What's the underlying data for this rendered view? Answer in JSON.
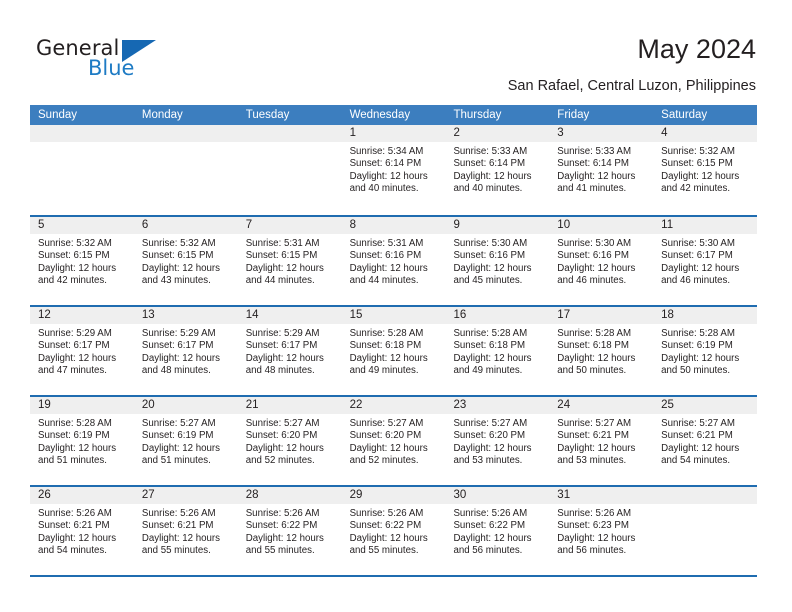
{
  "brand": {
    "name_part1": "General",
    "name_part2": "Blue",
    "triangle_color": "#1668b3",
    "blue_color": "#1e7bc4"
  },
  "header": {
    "title": "May 2024",
    "subtitle": "San Rafael, Central Luzon, Philippines"
  },
  "theme": {
    "header_blue": "#3c7ebf",
    "rule_blue": "#1f6cb0",
    "day_strip_gray": "#efefef",
    "text": "#231f20"
  },
  "calendar": {
    "weekdays": [
      "Sunday",
      "Monday",
      "Tuesday",
      "Wednesday",
      "Thursday",
      "Friday",
      "Saturday"
    ],
    "weeks": [
      [
        {
          "day": "",
          "sunrise": "",
          "sunset": "",
          "daylight": "",
          "empty": true
        },
        {
          "day": "",
          "sunrise": "",
          "sunset": "",
          "daylight": "",
          "empty": true
        },
        {
          "day": "",
          "sunrise": "",
          "sunset": "",
          "daylight": "",
          "empty": true
        },
        {
          "day": "1",
          "sunrise": "Sunrise: 5:34 AM",
          "sunset": "Sunset: 6:14 PM",
          "daylight": "Daylight: 12 hours and 40 minutes."
        },
        {
          "day": "2",
          "sunrise": "Sunrise: 5:33 AM",
          "sunset": "Sunset: 6:14 PM",
          "daylight": "Daylight: 12 hours and 40 minutes."
        },
        {
          "day": "3",
          "sunrise": "Sunrise: 5:33 AM",
          "sunset": "Sunset: 6:14 PM",
          "daylight": "Daylight: 12 hours and 41 minutes."
        },
        {
          "day": "4",
          "sunrise": "Sunrise: 5:32 AM",
          "sunset": "Sunset: 6:15 PM",
          "daylight": "Daylight: 12 hours and 42 minutes."
        }
      ],
      [
        {
          "day": "5",
          "sunrise": "Sunrise: 5:32 AM",
          "sunset": "Sunset: 6:15 PM",
          "daylight": "Daylight: 12 hours and 42 minutes."
        },
        {
          "day": "6",
          "sunrise": "Sunrise: 5:32 AM",
          "sunset": "Sunset: 6:15 PM",
          "daylight": "Daylight: 12 hours and 43 minutes."
        },
        {
          "day": "7",
          "sunrise": "Sunrise: 5:31 AM",
          "sunset": "Sunset: 6:15 PM",
          "daylight": "Daylight: 12 hours and 44 minutes."
        },
        {
          "day": "8",
          "sunrise": "Sunrise: 5:31 AM",
          "sunset": "Sunset: 6:16 PM",
          "daylight": "Daylight: 12 hours and 44 minutes."
        },
        {
          "day": "9",
          "sunrise": "Sunrise: 5:30 AM",
          "sunset": "Sunset: 6:16 PM",
          "daylight": "Daylight: 12 hours and 45 minutes."
        },
        {
          "day": "10",
          "sunrise": "Sunrise: 5:30 AM",
          "sunset": "Sunset: 6:16 PM",
          "daylight": "Daylight: 12 hours and 46 minutes."
        },
        {
          "day": "11",
          "sunrise": "Sunrise: 5:30 AM",
          "sunset": "Sunset: 6:17 PM",
          "daylight": "Daylight: 12 hours and 46 minutes."
        }
      ],
      [
        {
          "day": "12",
          "sunrise": "Sunrise: 5:29 AM",
          "sunset": "Sunset: 6:17 PM",
          "daylight": "Daylight: 12 hours and 47 minutes."
        },
        {
          "day": "13",
          "sunrise": "Sunrise: 5:29 AM",
          "sunset": "Sunset: 6:17 PM",
          "daylight": "Daylight: 12 hours and 48 minutes."
        },
        {
          "day": "14",
          "sunrise": "Sunrise: 5:29 AM",
          "sunset": "Sunset: 6:17 PM",
          "daylight": "Daylight: 12 hours and 48 minutes."
        },
        {
          "day": "15",
          "sunrise": "Sunrise: 5:28 AM",
          "sunset": "Sunset: 6:18 PM",
          "daylight": "Daylight: 12 hours and 49 minutes."
        },
        {
          "day": "16",
          "sunrise": "Sunrise: 5:28 AM",
          "sunset": "Sunset: 6:18 PM",
          "daylight": "Daylight: 12 hours and 49 minutes."
        },
        {
          "day": "17",
          "sunrise": "Sunrise: 5:28 AM",
          "sunset": "Sunset: 6:18 PM",
          "daylight": "Daylight: 12 hours and 50 minutes."
        },
        {
          "day": "18",
          "sunrise": "Sunrise: 5:28 AM",
          "sunset": "Sunset: 6:19 PM",
          "daylight": "Daylight: 12 hours and 50 minutes."
        }
      ],
      [
        {
          "day": "19",
          "sunrise": "Sunrise: 5:28 AM",
          "sunset": "Sunset: 6:19 PM",
          "daylight": "Daylight: 12 hours and 51 minutes."
        },
        {
          "day": "20",
          "sunrise": "Sunrise: 5:27 AM",
          "sunset": "Sunset: 6:19 PM",
          "daylight": "Daylight: 12 hours and 51 minutes."
        },
        {
          "day": "21",
          "sunrise": "Sunrise: 5:27 AM",
          "sunset": "Sunset: 6:20 PM",
          "daylight": "Daylight: 12 hours and 52 minutes."
        },
        {
          "day": "22",
          "sunrise": "Sunrise: 5:27 AM",
          "sunset": "Sunset: 6:20 PM",
          "daylight": "Daylight: 12 hours and 52 minutes."
        },
        {
          "day": "23",
          "sunrise": "Sunrise: 5:27 AM",
          "sunset": "Sunset: 6:20 PM",
          "daylight": "Daylight: 12 hours and 53 minutes."
        },
        {
          "day": "24",
          "sunrise": "Sunrise: 5:27 AM",
          "sunset": "Sunset: 6:21 PM",
          "daylight": "Daylight: 12 hours and 53 minutes."
        },
        {
          "day": "25",
          "sunrise": "Sunrise: 5:27 AM",
          "sunset": "Sunset: 6:21 PM",
          "daylight": "Daylight: 12 hours and 54 minutes."
        }
      ],
      [
        {
          "day": "26",
          "sunrise": "Sunrise: 5:26 AM",
          "sunset": "Sunset: 6:21 PM",
          "daylight": "Daylight: 12 hours and 54 minutes."
        },
        {
          "day": "27",
          "sunrise": "Sunrise: 5:26 AM",
          "sunset": "Sunset: 6:21 PM",
          "daylight": "Daylight: 12 hours and 55 minutes."
        },
        {
          "day": "28",
          "sunrise": "Sunrise: 5:26 AM",
          "sunset": "Sunset: 6:22 PM",
          "daylight": "Daylight: 12 hours and 55 minutes."
        },
        {
          "day": "29",
          "sunrise": "Sunrise: 5:26 AM",
          "sunset": "Sunset: 6:22 PM",
          "daylight": "Daylight: 12 hours and 55 minutes."
        },
        {
          "day": "30",
          "sunrise": "Sunrise: 5:26 AM",
          "sunset": "Sunset: 6:22 PM",
          "daylight": "Daylight: 12 hours and 56 minutes."
        },
        {
          "day": "31",
          "sunrise": "Sunrise: 5:26 AM",
          "sunset": "Sunset: 6:23 PM",
          "daylight": "Daylight: 12 hours and 56 minutes."
        },
        {
          "day": "",
          "sunrise": "",
          "sunset": "",
          "daylight": "",
          "empty": true
        }
      ]
    ]
  }
}
